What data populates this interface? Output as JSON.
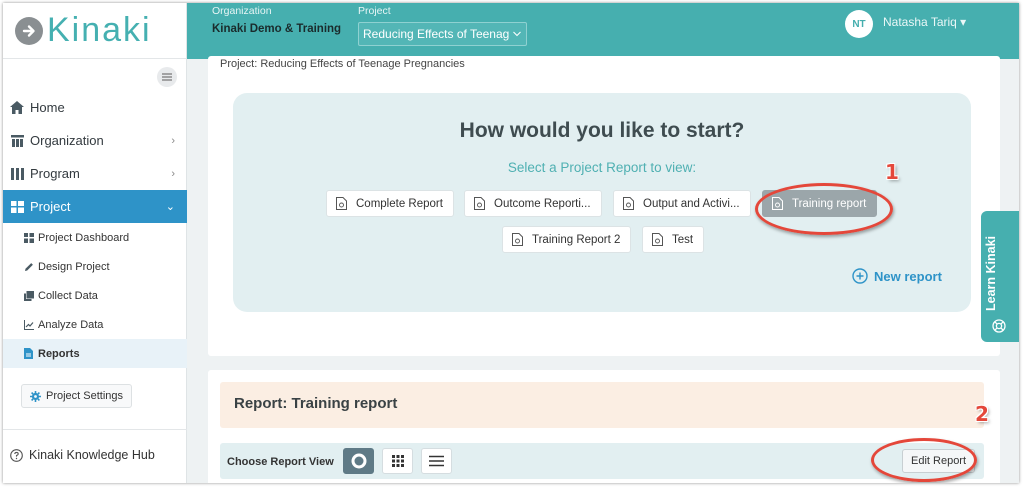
{
  "app": {
    "logo_text": "Kinaki",
    "brand_color": "#46afaf",
    "accent_color": "#2e93c8"
  },
  "header": {
    "org_label": "Organization",
    "org_name": "Kinaki Demo & Training",
    "project_label": "Project",
    "project_value": "Reducing Effects of Teenag",
    "user_initials": "NT",
    "user_name": "Natasha Tariq ▾"
  },
  "sidebar": {
    "items": [
      {
        "label": "Home",
        "icon": "home-icon"
      },
      {
        "label": "Organization",
        "icon": "organization-icon"
      },
      {
        "label": "Program",
        "icon": "program-icon"
      },
      {
        "label": "Project",
        "icon": "project-icon"
      }
    ],
    "sub_items": [
      {
        "label": "Project Dashboard",
        "icon": "dashboard-icon"
      },
      {
        "label": "Design Project",
        "icon": "pencil-icon"
      },
      {
        "label": "Collect Data",
        "icon": "collect-icon"
      },
      {
        "label": "Analyze Data",
        "icon": "chart-icon"
      },
      {
        "label": "Reports",
        "icon": "report-icon"
      }
    ],
    "settings_label": "Project Settings",
    "hub_label": "Kinaki Knowledge Hub"
  },
  "main": {
    "breadcrumb": "Project: Reducing Effects of Teenage Pregnancies",
    "start_title": "How would you like to start?",
    "start_subtitle": "Select a Project Report to view:",
    "reports": [
      "Complete Report",
      "Outcome Reporti...",
      "Output and Activi...",
      "Training report",
      "Training Report 2",
      "Test"
    ],
    "selected_report": "Training report",
    "new_report_label": "New report"
  },
  "report_section": {
    "title": "Report: Training report",
    "view_label": "Choose Report View",
    "edit_label": "Edit Report"
  },
  "learn_tab": {
    "label": "Learn Kinaki"
  },
  "annotations": {
    "first": "1",
    "second": "2",
    "color": "#e4473a"
  }
}
